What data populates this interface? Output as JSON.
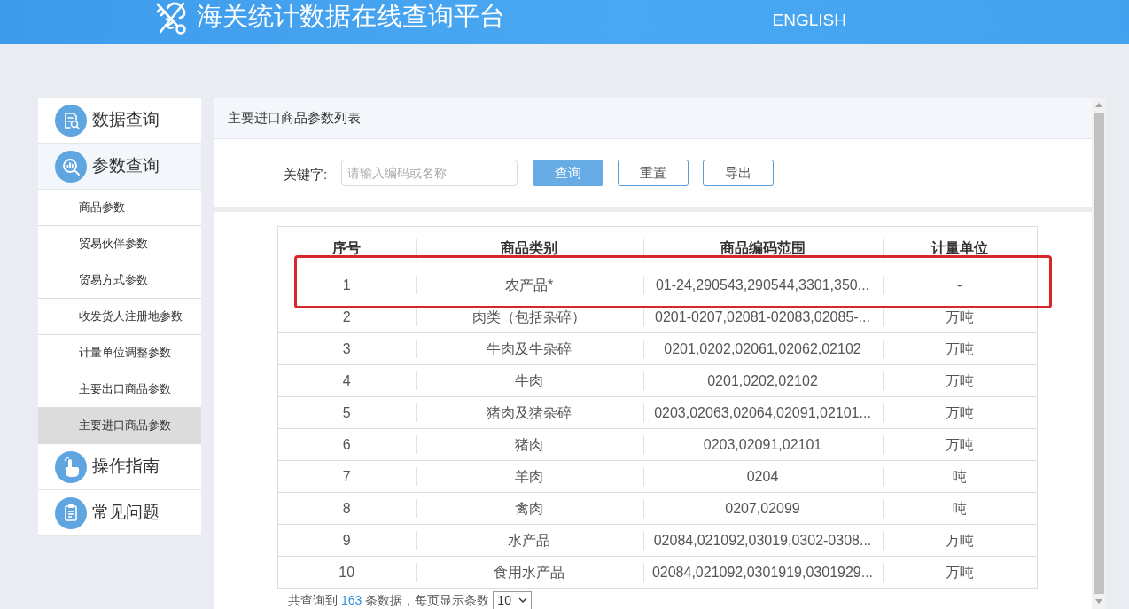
{
  "header": {
    "title": "海关统计数据在线查询平台",
    "language_link": "ENGLISH"
  },
  "sidebar": {
    "items": [
      {
        "label": "数据查询",
        "expanded": false
      },
      {
        "label": "参数查询",
        "expanded": true,
        "children": [
          {
            "label": "商品参数",
            "selected": false
          },
          {
            "label": "贸易伙伴参数",
            "selected": false
          },
          {
            "label": "贸易方式参数",
            "selected": false
          },
          {
            "label": "收发货人注册地参数",
            "selected": false
          },
          {
            "label": "计量单位调整参数",
            "selected": false
          },
          {
            "label": "主要出口商品参数",
            "selected": false
          },
          {
            "label": "主要进口商品参数",
            "selected": true
          }
        ]
      },
      {
        "label": "操作指南",
        "expanded": false
      },
      {
        "label": "常见问题",
        "expanded": false
      }
    ]
  },
  "panel": {
    "title": "主要进口商品参数列表",
    "search": {
      "label": "关键字:",
      "placeholder": "请输入编码或名称"
    },
    "buttons": [
      {
        "label": "查询",
        "kind": "primary"
      },
      {
        "label": "重置",
        "kind": "outline"
      },
      {
        "label": "导出",
        "kind": "outline"
      }
    ]
  },
  "table": {
    "columns": [
      "序号",
      "商品类别",
      "商品编码范围",
      "计量单位"
    ],
    "rows": [
      {
        "cells": [
          "1",
          "农产品*",
          "01-24,290543,290544,3301,350...",
          "-"
        ],
        "highlighted": true
      },
      {
        "cells": [
          "2",
          "肉类（包括杂碎）",
          "0201-0207,02081-02083,02085-...",
          "万吨"
        ],
        "highlighted": false
      },
      {
        "cells": [
          "3",
          "牛肉及牛杂碎",
          "0201,0202,02061,02062,02102",
          "万吨"
        ],
        "highlighted": false
      },
      {
        "cells": [
          "4",
          "牛肉",
          "0201,0202,02102",
          "万吨"
        ],
        "highlighted": false
      },
      {
        "cells": [
          "5",
          "猪肉及猪杂碎",
          "0203,02063,02064,02091,02101...",
          "万吨"
        ],
        "highlighted": false
      },
      {
        "cells": [
          "6",
          "猪肉",
          "0203,02091,02101",
          "万吨"
        ],
        "highlighted": false
      },
      {
        "cells": [
          "7",
          "羊肉",
          "0204",
          "吨"
        ],
        "highlighted": false
      },
      {
        "cells": [
          "8",
          "禽肉",
          "0207,02099",
          "吨"
        ],
        "highlighted": false
      },
      {
        "cells": [
          "9",
          "水产品",
          "02084,021092,03019,0302-0308...",
          "万吨"
        ],
        "highlighted": false
      },
      {
        "cells": [
          "10",
          "食用水产品",
          "02084,021092,0301919,0301929...",
          "万吨"
        ],
        "highlighted": false
      }
    ]
  },
  "footer": {
    "summary_prefix": "共查询到",
    "count": "163",
    "summary_suffix": "条数据，每页显示条数",
    "page_size": "10"
  }
}
